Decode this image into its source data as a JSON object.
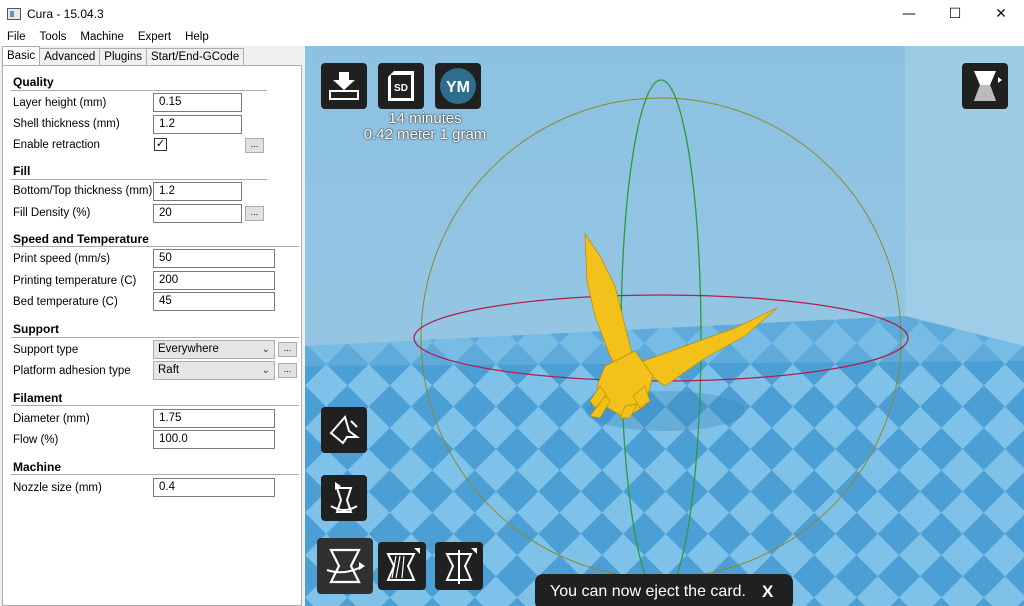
{
  "window": {
    "title": "Cura - 15.04.3",
    "minimize": "—",
    "maximize": "☐",
    "close": "✕"
  },
  "menu": [
    "File",
    "Tools",
    "Machine",
    "Expert",
    "Help"
  ],
  "tabs": [
    "Basic",
    "Advanced",
    "Plugins",
    "Start/End-GCode"
  ],
  "quality": {
    "title": "Quality",
    "layer_height_label": "Layer height (mm)",
    "layer_height": "0.15",
    "shell_thickness_label": "Shell thickness (mm)",
    "shell_thickness": "1.2",
    "retraction_label": "Enable retraction",
    "retraction_checked": "✓"
  },
  "fill": {
    "title": "Fill",
    "bottom_top_label": "Bottom/Top thickness (mm)",
    "bottom_top": "1.2",
    "density_label": "Fill Density (%)",
    "density": "20"
  },
  "speed": {
    "title": "Speed and Temperature",
    "print_speed_label": "Print speed (mm/s)",
    "print_speed": "50",
    "print_temp_label": "Printing temperature (C)",
    "print_temp": "200",
    "bed_temp_label": "Bed temperature (C)",
    "bed_temp": "45"
  },
  "support": {
    "title": "Support",
    "type_label": "Support type",
    "type": "Everywhere",
    "adhesion_label": "Platform adhesion type",
    "adhesion": "Raft"
  },
  "filament": {
    "title": "Filament",
    "diameter_label": "Diameter (mm)",
    "diameter": "1.75",
    "flow_label": "Flow (%)",
    "flow": "100.0"
  },
  "machine": {
    "title": "Machine",
    "nozzle_label": "Nozzle size (mm)",
    "nozzle": "0.4"
  },
  "dots": "...",
  "viewer": {
    "sd_label": "SD",
    "ym_label": "YM",
    "print_time": "14 minutes",
    "print_usage": "0.42 meter 1 gram",
    "toast_text": "You can now eject the card.",
    "toast_close": "X",
    "colors": {
      "sky": "#8fc3e2",
      "floor_light": "#7fc3ea",
      "floor_dark": "#4a9ed3",
      "model": "#f2c21a"
    }
  }
}
